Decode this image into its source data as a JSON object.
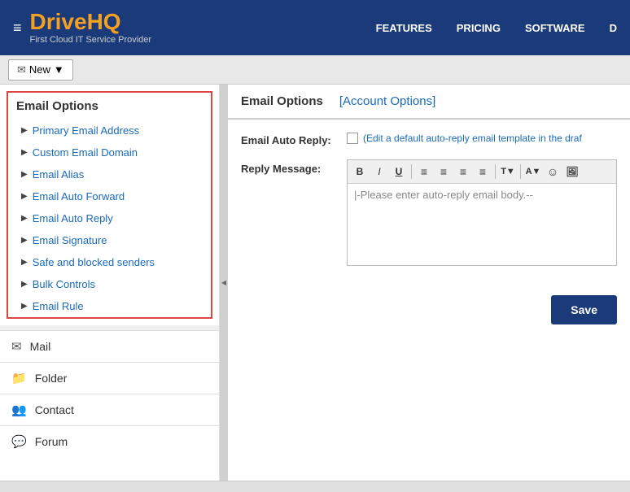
{
  "header": {
    "menu_icon": "≡",
    "logo_main": "Drive",
    "logo_accent": "HQ",
    "logo_sub": "First Cloud IT Service Provider",
    "nav": [
      {
        "label": "FEATURES",
        "key": "features"
      },
      {
        "label": "PRICING",
        "key": "pricing"
      },
      {
        "label": "SOFTWARE",
        "key": "software"
      },
      {
        "label": "D",
        "key": "d"
      }
    ]
  },
  "toolbar": {
    "new_label": "New",
    "new_dropdown_icon": "▼"
  },
  "sidebar": {
    "section_title": "Email Options",
    "items": [
      {
        "label": "Primary Email Address",
        "key": "primary-email"
      },
      {
        "label": "Custom Email Domain",
        "key": "custom-domain"
      },
      {
        "label": "Email Alias",
        "key": "email-alias"
      },
      {
        "label": "Email Auto Forward",
        "key": "email-auto-forward"
      },
      {
        "label": "Email Auto Reply",
        "key": "email-auto-reply"
      },
      {
        "label": "Email Signature",
        "key": "email-signature"
      },
      {
        "label": "Safe and blocked senders",
        "key": "safe-blocked"
      },
      {
        "label": "Bulk Controls",
        "key": "bulk-controls"
      },
      {
        "label": "Email Rule",
        "key": "email-rule"
      }
    ],
    "nav_items": [
      {
        "label": "Mail",
        "icon": "✉",
        "key": "mail"
      },
      {
        "label": "Folder",
        "icon": "📁",
        "key": "folder"
      },
      {
        "label": "Contact",
        "icon": "👥",
        "key": "contact"
      },
      {
        "label": "Forum",
        "icon": "💬",
        "key": "forum"
      }
    ]
  },
  "content": {
    "header": {
      "title": "Email Options",
      "link_label": "[Account Options]"
    },
    "form": {
      "auto_reply_label": "Email Auto Reply:",
      "auto_reply_description": "(Edit a default auto-reply email template in the draf",
      "reply_message_label": "Reply Message:",
      "editor_placeholder": "|-Please enter auto-reply email body.--",
      "toolbar_buttons": [
        {
          "icon": "B",
          "key": "bold",
          "style": "bold"
        },
        {
          "icon": "I",
          "key": "italic",
          "style": "italic"
        },
        {
          "icon": "U",
          "key": "underline",
          "style": "underline"
        },
        {
          "icon": "≡",
          "key": "align-left"
        },
        {
          "icon": "≡",
          "key": "align-center"
        },
        {
          "icon": "≡",
          "key": "align-right"
        },
        {
          "icon": "≡",
          "key": "align-justify"
        },
        {
          "icon": "T",
          "key": "text-format"
        },
        {
          "icon": "▼",
          "key": "text-format-dropdown"
        },
        {
          "icon": "A",
          "key": "font-color"
        },
        {
          "icon": "☺",
          "key": "emoji"
        },
        {
          "icon": "🖼",
          "key": "image"
        }
      ],
      "save_label": "Save"
    }
  }
}
